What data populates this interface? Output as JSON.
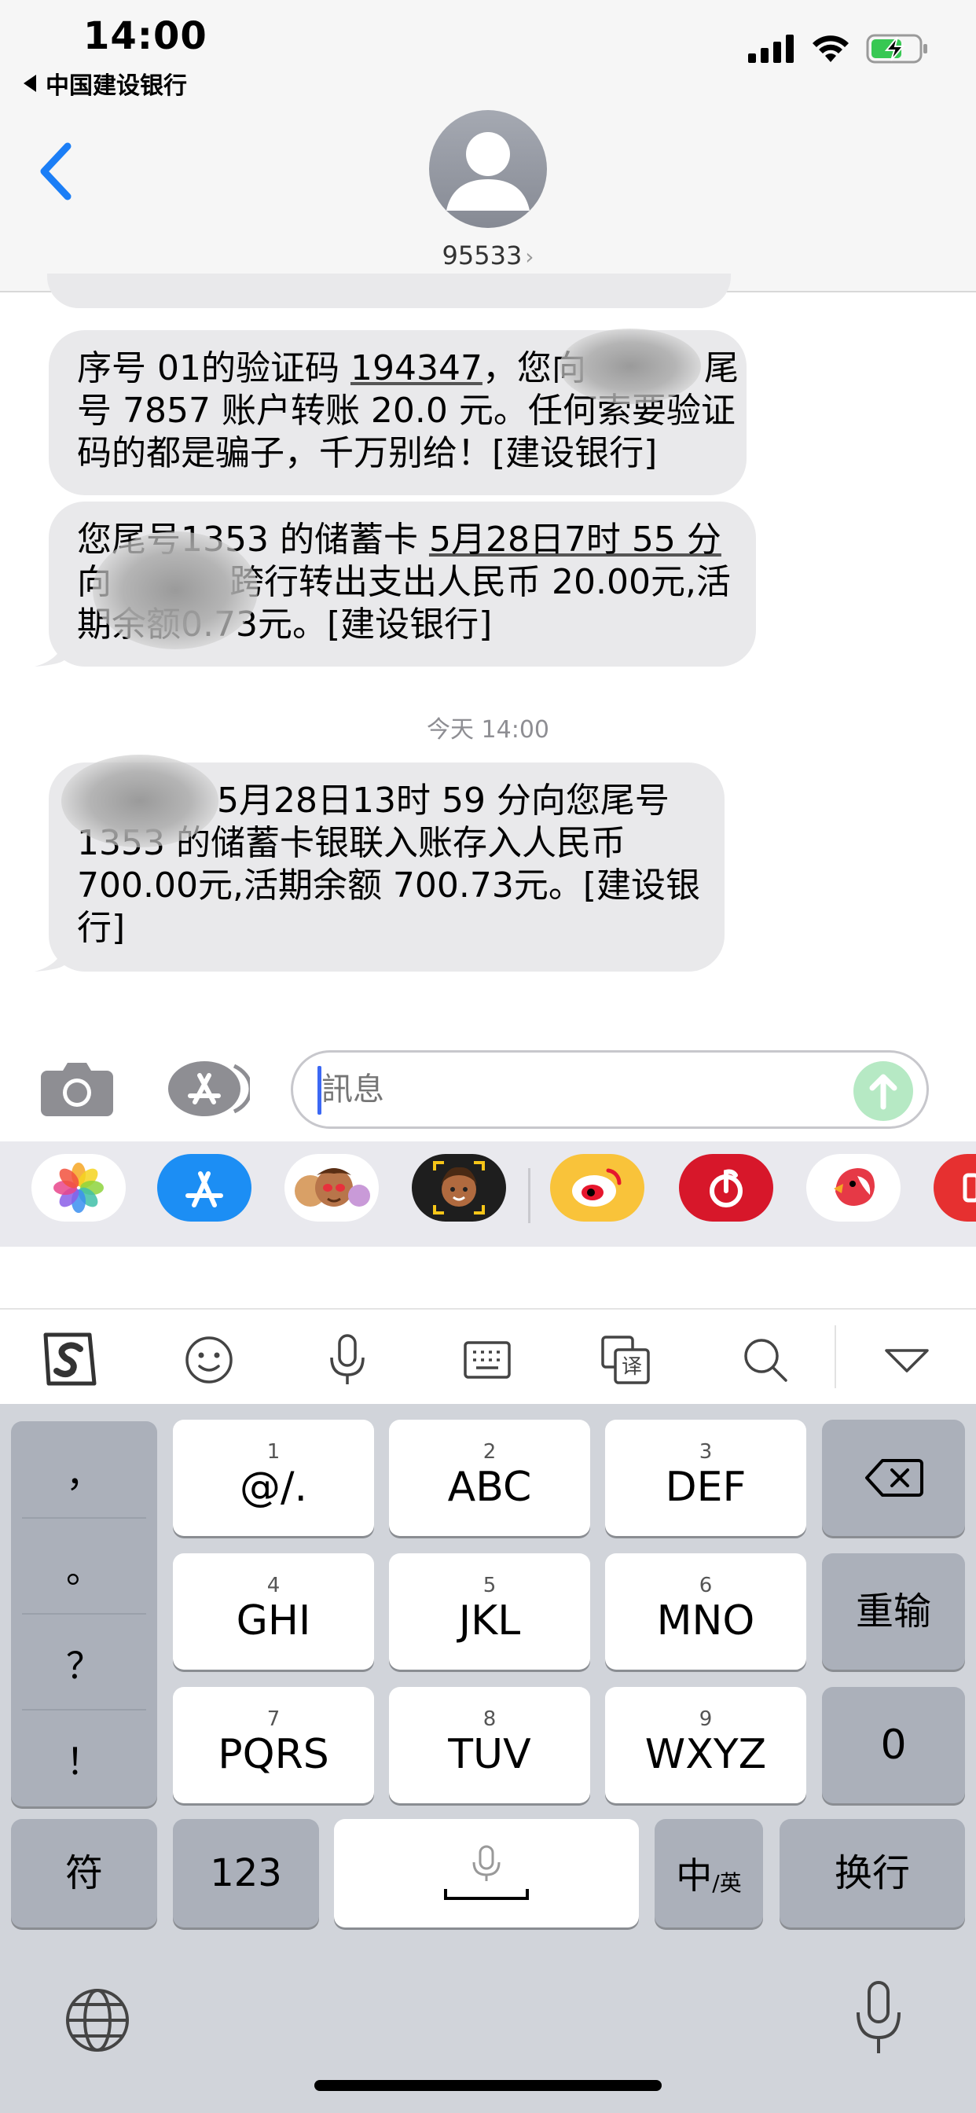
{
  "status_bar": {
    "time": "14:00",
    "back_app_label": "中国建设银行"
  },
  "header": {
    "contact_name": "95533",
    "contact_chevron": "›",
    "back_icon": "chevron-left-icon",
    "accent_color": "#1b7ef6"
  },
  "messages": [
    {
      "lines": [
        "序号 01的验证码 194347，您向",
        "尾",
        "号 7857 账户转账 20.0 元。任何索要验证",
        "码的都是骗子，千万别给！[建设银行]"
      ],
      "line1_prefix": "序号 01的验证码 ",
      "line1_code": "194347",
      "line1_suffix": "，您向",
      "line1_end": "尾",
      "line2": "号 7857 账户转账 20.0 元。任何索要验证",
      "line3": "码的都是骗子，千万别给！[建设银行]"
    },
    {
      "line1_prefix": "您尾号1353 的储蓄卡 ",
      "line1_date": "5月28日7时 55 分",
      "line2_prefix": "向",
      "line2_suffix": "跨行转出支出人民币 20.00元,活",
      "line3_prefix": "期余额",
      "line3_suffix": "0.73元。[建设银行]"
    },
    {
      "line1": "5月28日13时 59 分向您尾号",
      "line2": "1353 的储蓄卡银联入账存入人民币",
      "line3": "700.00元,活期余额 700.73元。[建设银",
      "line4": "行]"
    }
  ],
  "day_label": "今天 14:00",
  "input": {
    "placeholder": "訊息"
  },
  "app_drawer": [
    "photos-icon",
    "app-store-icon",
    "memoji-stickers-icon",
    "memoji-icon",
    "weibo-icon",
    "netease-music-icon",
    "bird-app-icon",
    "partial-app-icon"
  ],
  "ime_toolbar": [
    "sogou-logo-icon",
    "emoji-icon",
    "microphone-icon",
    "keyboard-icon",
    "translate-icon",
    "search-icon",
    "collapse-keyboard-icon"
  ],
  "keyboard": {
    "punctuation": [
      "，",
      "。",
      "？",
      "！"
    ],
    "keys": [
      {
        "num": "1",
        "label": "@/."
      },
      {
        "num": "2",
        "label": "ABC"
      },
      {
        "num": "3",
        "label": "DEF"
      },
      {
        "num": "4",
        "label": "GHI"
      },
      {
        "num": "5",
        "label": "JKL"
      },
      {
        "num": "6",
        "label": "MNO"
      },
      {
        "num": "7",
        "label": "PQRS"
      },
      {
        "num": "8",
        "label": "TUV"
      },
      {
        "num": "9",
        "label": "WXYZ"
      }
    ],
    "delete_icon": "backspace-icon",
    "reenter_label": "重输",
    "zero_label": "0",
    "symbol_label": "符",
    "numbers_label": "123",
    "lang_main": "中",
    "lang_sub": "/英",
    "return_label": "换行",
    "globe_icon": "globe-icon",
    "dictation_icon": "microphone-icon"
  }
}
